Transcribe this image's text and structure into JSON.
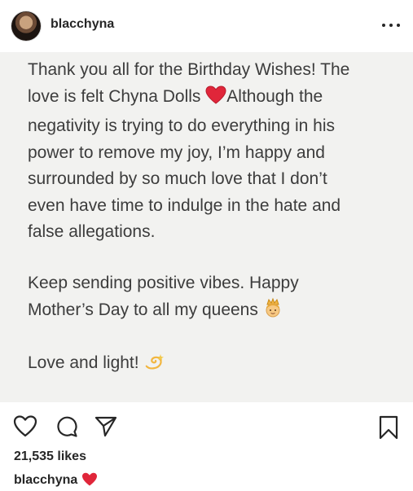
{
  "header": {
    "username": "blacchyna"
  },
  "post": {
    "paragraph1_part1": "Thank you all for the Birthday Wishes! The\nlove is felt Chyna Dolls ",
    "paragraph1_part2": "Although the\nnegativity is trying to do everything in his\npower to remove my joy, I’m happy and\nsurrounded by so much love that I don’t\neven have time to indulge in the hate and\nfalse allegations.",
    "paragraph2": "Keep sending positive vibes. Happy\nMother’s Day to all my queens ",
    "paragraph3": "Love and light! "
  },
  "footer": {
    "likes": "21,535 likes",
    "caption_username": "blacchyna"
  },
  "icons": {
    "heart_emoji": "red-heart-icon",
    "queen_emoji": "princess-emoji-icon",
    "dizzy_emoji": "dizzy-emoji-icon",
    "actions": [
      "heart-icon",
      "comment-icon",
      "share-icon",
      "bookmark-icon"
    ]
  },
  "colors": {
    "heart": "#e0263a",
    "crown": "#f2b640"
  }
}
